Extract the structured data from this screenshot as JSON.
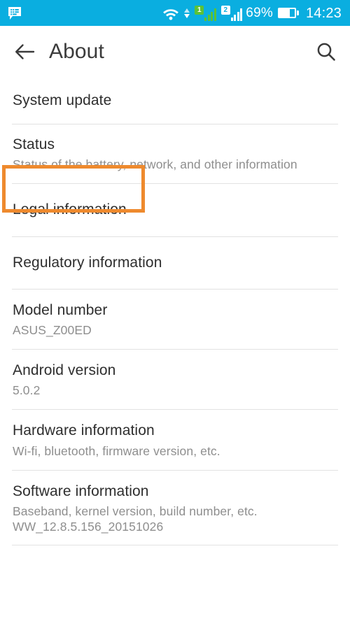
{
  "status_bar": {
    "notification_icon": "message-bubble-icon",
    "wifi_icon": "wifi-icon",
    "data_arrows_icon": "data-transfer-arrows-icon",
    "sim1": {
      "badge": "1",
      "icon": "signal-bars-sim1-icon",
      "bars_active": 3
    },
    "sim2": {
      "badge": "2",
      "icon": "signal-bars-sim2-icon",
      "bars_active": 3
    },
    "battery_percent": "69%",
    "battery_level": 69,
    "battery_icon": "battery-icon",
    "clock": "14:23",
    "background_color": "#0aaee0"
  },
  "app_bar": {
    "back_icon": "back-arrow-icon",
    "title": "About",
    "search_icon": "search-icon"
  },
  "highlight": {
    "color": "#ee8a2e",
    "target": "System update"
  },
  "list": {
    "items": [
      {
        "title": "System update",
        "subtitle": "",
        "subtitle2": "",
        "highlighted": true
      },
      {
        "title": "Status",
        "subtitle": "Status of the battery, network, and other information",
        "subtitle2": "",
        "highlighted": false
      },
      {
        "title": "Legal information",
        "subtitle": "",
        "subtitle2": "",
        "highlighted": false
      },
      {
        "title": "Regulatory information",
        "subtitle": "",
        "subtitle2": "",
        "highlighted": false
      },
      {
        "title": "Model number",
        "subtitle": "ASUS_Z00ED",
        "subtitle2": "",
        "highlighted": false
      },
      {
        "title": "Android version",
        "subtitle": "5.0.2",
        "subtitle2": "",
        "highlighted": false
      },
      {
        "title": "Hardware information",
        "subtitle": "Wi-fi, bluetooth, firmware version, etc.",
        "subtitle2": "",
        "highlighted": false
      },
      {
        "title": "Software information",
        "subtitle": "Baseband, kernel version, build number, etc.",
        "subtitle2": "WW_12.8.5.156_20151026",
        "highlighted": false
      }
    ]
  }
}
